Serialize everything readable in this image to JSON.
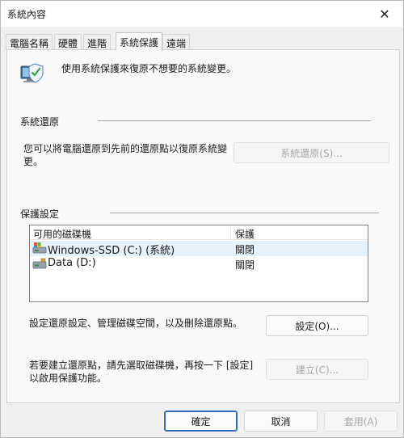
{
  "window": {
    "title": "系統內容",
    "close_glyph": "✕"
  },
  "tabs": [
    {
      "label": "電腦名稱"
    },
    {
      "label": "硬體"
    },
    {
      "label": "進階"
    },
    {
      "label": "系統保護",
      "active": true
    },
    {
      "label": "遠端"
    }
  ],
  "intro": {
    "text": "使用系統保護來復原不想要的系統變更。",
    "icon": "system-protection-icon"
  },
  "restore_section": {
    "title": "系統還原",
    "description": "您可以將電腦還原到先前的還原點以復原系統變\n更。",
    "button_label": "系統還原(S)..."
  },
  "protection_section": {
    "title": "保護設定",
    "columns": [
      "可用的磁碟機",
      "保護"
    ],
    "drives": [
      {
        "name": "Windows-SSD (C:) (系統)",
        "protection": "關閉",
        "icon": "system-drive-icon"
      },
      {
        "name": "Data (D:)",
        "protection": "關閉",
        "icon": "drive-icon"
      }
    ]
  },
  "configure": {
    "description": "設定還原設定、管理磁碟空間，以及刪除還原點。",
    "button_label": "設定(O)..."
  },
  "create": {
    "description": "若要建立還原點，請先選取磁碟機，再按一下 [設定]\n以啟用保護功能。",
    "button_label": "建立(C)..."
  },
  "footer": {
    "ok_label": "確定",
    "cancel_label": "取消",
    "apply_label": "套用(A)"
  },
  "colors": {
    "accent": "#2f6fb7",
    "selection": "#e5f1fb"
  }
}
